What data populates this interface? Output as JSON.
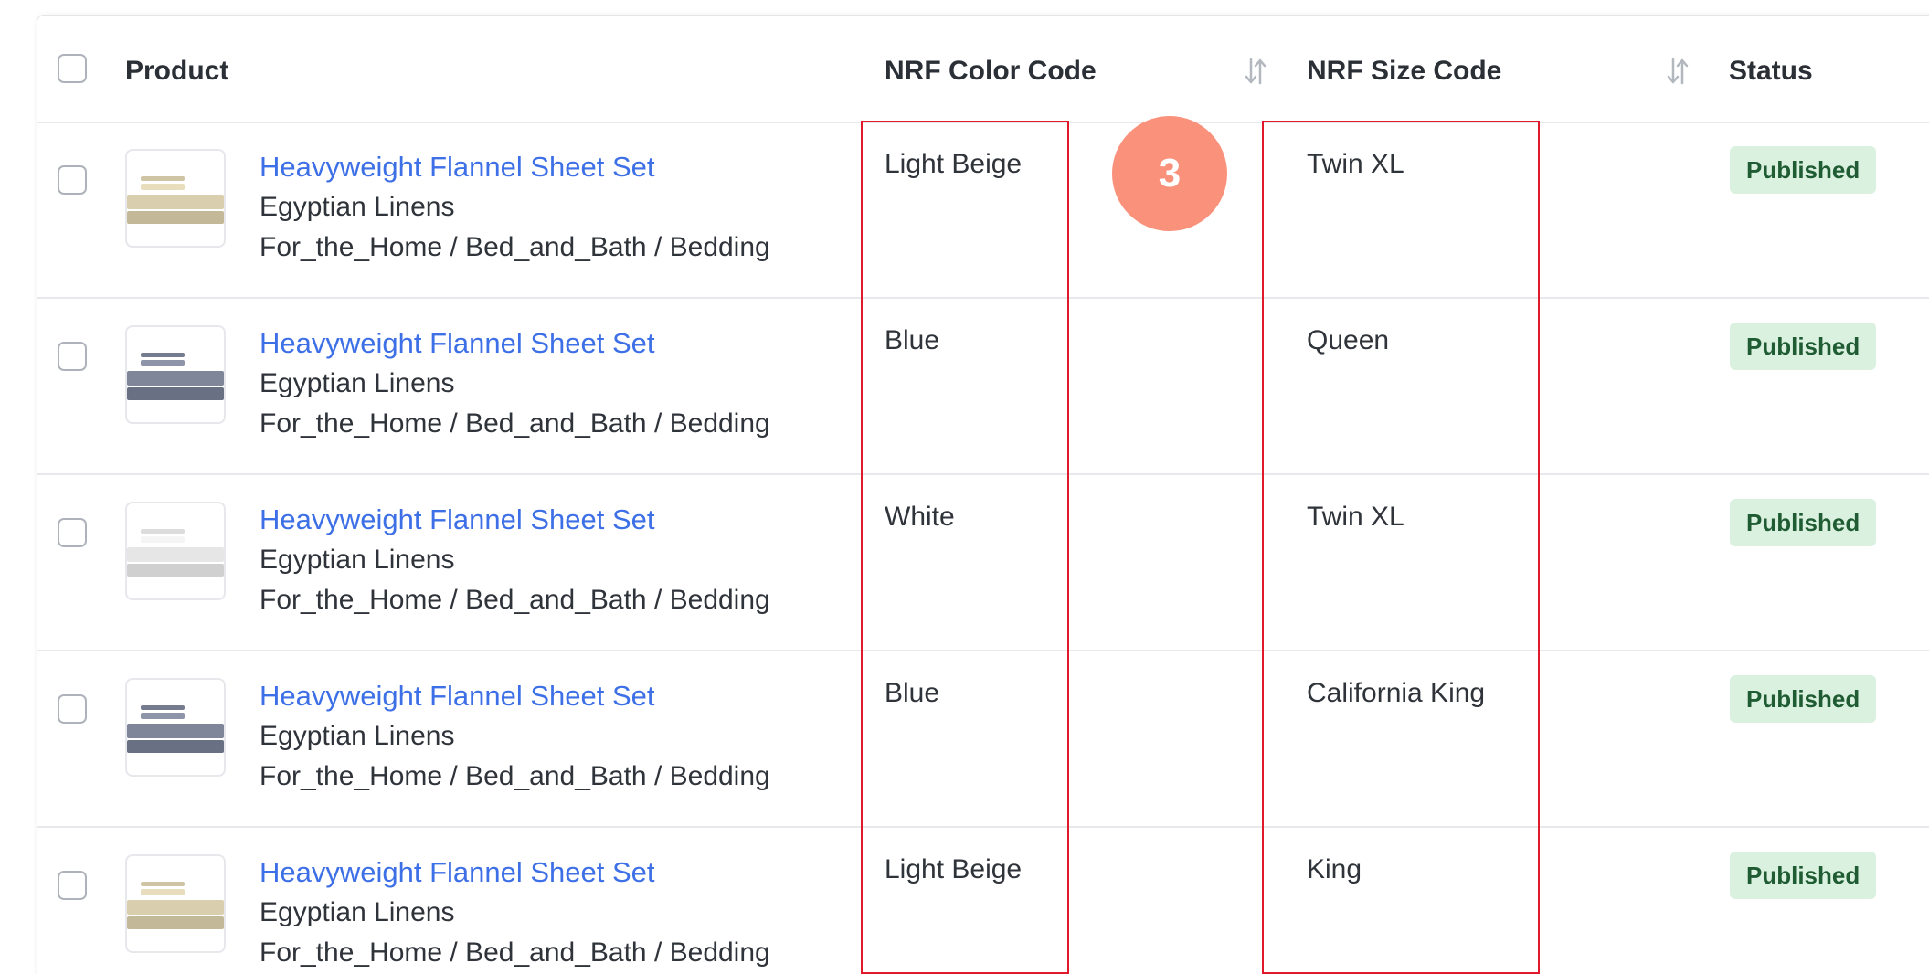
{
  "table": {
    "columns": {
      "product": "Product",
      "color": "NRF Color Code",
      "size": "NRF Size Code",
      "status": "Status"
    },
    "rows": [
      {
        "name": "Heavyweight Flannel Sheet Set",
        "brand": "Egyptian Linens",
        "category": "For_the_Home / Bed_and_Bath / Bedding",
        "color": "Light Beige",
        "size": "Twin XL",
        "status": "Published",
        "thumb_color": "#d9cfae"
      },
      {
        "name": "Heavyweight Flannel Sheet Set",
        "brand": "Egyptian Linens",
        "category": "For_the_Home / Bed_and_Bath / Bedding",
        "color": "Blue",
        "size": "Queen",
        "status": "Published",
        "thumb_color": "#7f8699"
      },
      {
        "name": "Heavyweight Flannel Sheet Set",
        "brand": "Egyptian Linens",
        "category": "For_the_Home / Bed_and_Bath / Bedding",
        "color": "White",
        "size": "Twin XL",
        "status": "Published",
        "thumb_color": "#e6e6e6"
      },
      {
        "name": "Heavyweight Flannel Sheet Set",
        "brand": "Egyptian Linens",
        "category": "For_the_Home / Bed_and_Bath / Bedding",
        "color": "Blue",
        "size": "California King",
        "status": "Published",
        "thumb_color": "#7f8699"
      },
      {
        "name": "Heavyweight Flannel Sheet Set",
        "brand": "Egyptian Linens",
        "category": "For_the_Home / Bed_and_Bath / Bedding",
        "color": "Light Beige",
        "size": "King",
        "status": "Published",
        "thumb_color": "#d9cfae"
      }
    ]
  },
  "annotation": {
    "step": "3",
    "badge_color": "#f9917b",
    "box_color": "#e0192b"
  },
  "colors": {
    "link": "#3d6fe6",
    "badge_bg": "#dbf1df",
    "badge_text": "#1f5c33"
  },
  "icons": {
    "sort": "sort-arrows-icon",
    "checkbox": "checkbox-icon"
  }
}
